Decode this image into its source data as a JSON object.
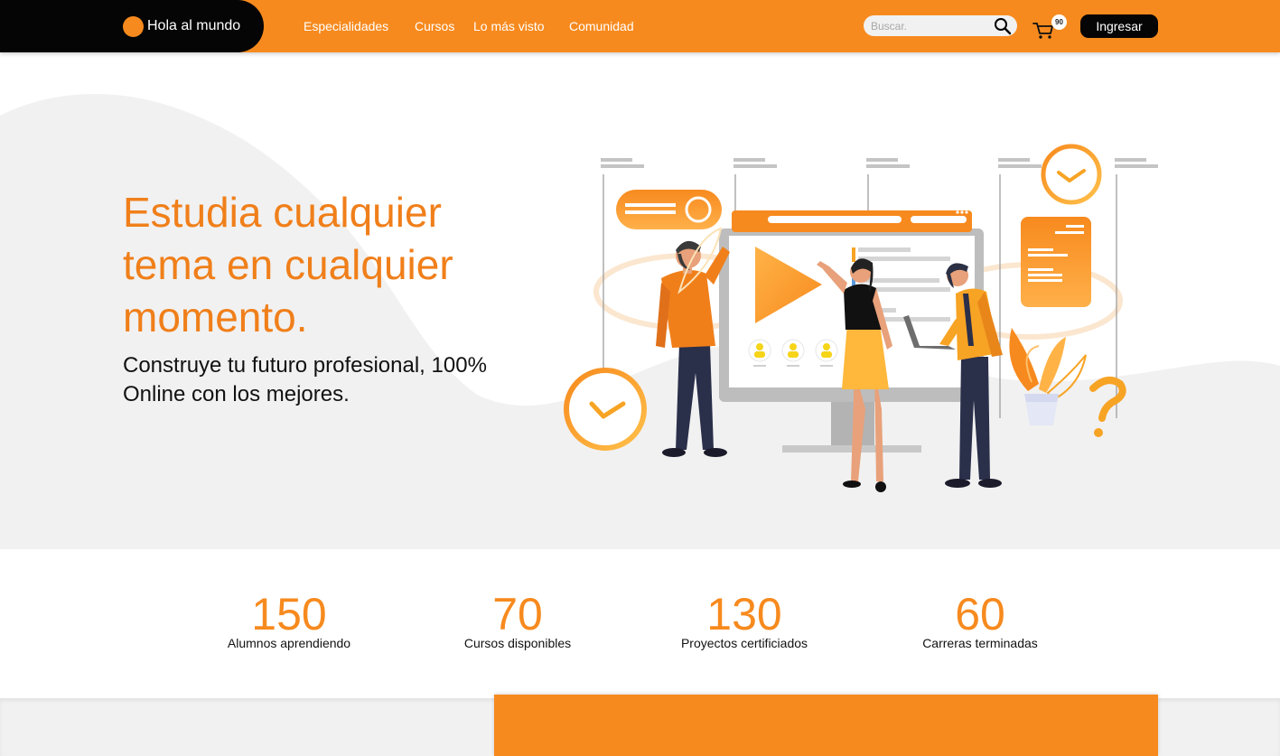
{
  "brand": {
    "name": "Hola al mundo"
  },
  "nav": {
    "links": [
      "Especialidades",
      "Cursos",
      "Lo más visto",
      "Comunidad"
    ],
    "search_placeholder": "Buscar.",
    "cart_count": "90",
    "login_label": "Ingresar"
  },
  "hero": {
    "title": "Estudia cualquier tema en cualquier momento.",
    "subtitle": "Construye tu futuro profesional, 100% Online con los mejores."
  },
  "stats": [
    {
      "value": "150",
      "label": "Alumnos aprendiendo"
    },
    {
      "value": "70",
      "label": "Cursos disponibles"
    },
    {
      "value": "130",
      "label": "Proyectos certificiados"
    },
    {
      "value": "60",
      "label": "Carreras terminadas"
    }
  ],
  "colors": {
    "accent": "#f78a1e",
    "title_orange": "#f07f1a",
    "dark": "#050505",
    "hero_bg": "#f1f1f1"
  },
  "icons": [
    "search-icon",
    "cart-icon",
    "play-icon",
    "clock-icon",
    "question-mark-icon"
  ]
}
